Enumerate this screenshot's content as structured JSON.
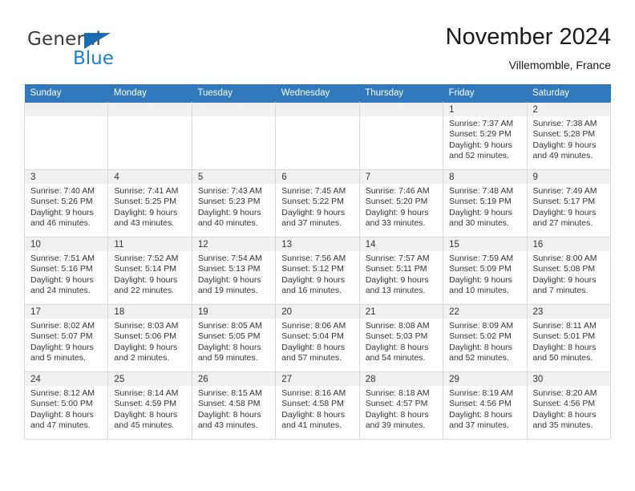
{
  "brand": {
    "name_part1": "General",
    "name_part2": "Blue",
    "accent_color": "#1b7fd4",
    "triangle_color": "#1b6cb5"
  },
  "header": {
    "title": "November 2024",
    "subtitle": "Villemomble, France"
  },
  "theme": {
    "header_row_color": "#3079bd",
    "day_band_color": "#f0f0f0",
    "cell_border_color": "#d9d9d9",
    "text_color": "#333333"
  },
  "weekday_headers": [
    "Sunday",
    "Monday",
    "Tuesday",
    "Wednesday",
    "Thursday",
    "Friday",
    "Saturday"
  ],
  "weeks": [
    [
      {
        "day": "",
        "empty": true
      },
      {
        "day": "",
        "empty": true
      },
      {
        "day": "",
        "empty": true
      },
      {
        "day": "",
        "empty": true
      },
      {
        "day": "",
        "empty": true
      },
      {
        "day": "1",
        "sunrise": "Sunrise: 7:37 AM",
        "sunset": "Sunset: 5:29 PM",
        "daylight_line1": "Daylight: 9 hours",
        "daylight_line2": "and 52 minutes."
      },
      {
        "day": "2",
        "sunrise": "Sunrise: 7:38 AM",
        "sunset": "Sunset: 5:28 PM",
        "daylight_line1": "Daylight: 9 hours",
        "daylight_line2": "and 49 minutes."
      }
    ],
    [
      {
        "day": "3",
        "sunrise": "Sunrise: 7:40 AM",
        "sunset": "Sunset: 5:26 PM",
        "daylight_line1": "Daylight: 9 hours",
        "daylight_line2": "and 46 minutes."
      },
      {
        "day": "4",
        "sunrise": "Sunrise: 7:41 AM",
        "sunset": "Sunset: 5:25 PM",
        "daylight_line1": "Daylight: 9 hours",
        "daylight_line2": "and 43 minutes."
      },
      {
        "day": "5",
        "sunrise": "Sunrise: 7:43 AM",
        "sunset": "Sunset: 5:23 PM",
        "daylight_line1": "Daylight: 9 hours",
        "daylight_line2": "and 40 minutes."
      },
      {
        "day": "6",
        "sunrise": "Sunrise: 7:45 AM",
        "sunset": "Sunset: 5:22 PM",
        "daylight_line1": "Daylight: 9 hours",
        "daylight_line2": "and 37 minutes."
      },
      {
        "day": "7",
        "sunrise": "Sunrise: 7:46 AM",
        "sunset": "Sunset: 5:20 PM",
        "daylight_line1": "Daylight: 9 hours",
        "daylight_line2": "and 33 minutes."
      },
      {
        "day": "8",
        "sunrise": "Sunrise: 7:48 AM",
        "sunset": "Sunset: 5:19 PM",
        "daylight_line1": "Daylight: 9 hours",
        "daylight_line2": "and 30 minutes."
      },
      {
        "day": "9",
        "sunrise": "Sunrise: 7:49 AM",
        "sunset": "Sunset: 5:17 PM",
        "daylight_line1": "Daylight: 9 hours",
        "daylight_line2": "and 27 minutes."
      }
    ],
    [
      {
        "day": "10",
        "sunrise": "Sunrise: 7:51 AM",
        "sunset": "Sunset: 5:16 PM",
        "daylight_line1": "Daylight: 9 hours",
        "daylight_line2": "and 24 minutes."
      },
      {
        "day": "11",
        "sunrise": "Sunrise: 7:52 AM",
        "sunset": "Sunset: 5:14 PM",
        "daylight_line1": "Daylight: 9 hours",
        "daylight_line2": "and 22 minutes."
      },
      {
        "day": "12",
        "sunrise": "Sunrise: 7:54 AM",
        "sunset": "Sunset: 5:13 PM",
        "daylight_line1": "Daylight: 9 hours",
        "daylight_line2": "and 19 minutes."
      },
      {
        "day": "13",
        "sunrise": "Sunrise: 7:56 AM",
        "sunset": "Sunset: 5:12 PM",
        "daylight_line1": "Daylight: 9 hours",
        "daylight_line2": "and 16 minutes."
      },
      {
        "day": "14",
        "sunrise": "Sunrise: 7:57 AM",
        "sunset": "Sunset: 5:11 PM",
        "daylight_line1": "Daylight: 9 hours",
        "daylight_line2": "and 13 minutes."
      },
      {
        "day": "15",
        "sunrise": "Sunrise: 7:59 AM",
        "sunset": "Sunset: 5:09 PM",
        "daylight_line1": "Daylight: 9 hours",
        "daylight_line2": "and 10 minutes."
      },
      {
        "day": "16",
        "sunrise": "Sunrise: 8:00 AM",
        "sunset": "Sunset: 5:08 PM",
        "daylight_line1": "Daylight: 9 hours",
        "daylight_line2": "and 7 minutes."
      }
    ],
    [
      {
        "day": "17",
        "sunrise": "Sunrise: 8:02 AM",
        "sunset": "Sunset: 5:07 PM",
        "daylight_line1": "Daylight: 9 hours",
        "daylight_line2": "and 5 minutes."
      },
      {
        "day": "18",
        "sunrise": "Sunrise: 8:03 AM",
        "sunset": "Sunset: 5:06 PM",
        "daylight_line1": "Daylight: 9 hours",
        "daylight_line2": "and 2 minutes."
      },
      {
        "day": "19",
        "sunrise": "Sunrise: 8:05 AM",
        "sunset": "Sunset: 5:05 PM",
        "daylight_line1": "Daylight: 8 hours",
        "daylight_line2": "and 59 minutes."
      },
      {
        "day": "20",
        "sunrise": "Sunrise: 8:06 AM",
        "sunset": "Sunset: 5:04 PM",
        "daylight_line1": "Daylight: 8 hours",
        "daylight_line2": "and 57 minutes."
      },
      {
        "day": "21",
        "sunrise": "Sunrise: 8:08 AM",
        "sunset": "Sunset: 5:03 PM",
        "daylight_line1": "Daylight: 8 hours",
        "daylight_line2": "and 54 minutes."
      },
      {
        "day": "22",
        "sunrise": "Sunrise: 8:09 AM",
        "sunset": "Sunset: 5:02 PM",
        "daylight_line1": "Daylight: 8 hours",
        "daylight_line2": "and 52 minutes."
      },
      {
        "day": "23",
        "sunrise": "Sunrise: 8:11 AM",
        "sunset": "Sunset: 5:01 PM",
        "daylight_line1": "Daylight: 8 hours",
        "daylight_line2": "and 50 minutes."
      }
    ],
    [
      {
        "day": "24",
        "sunrise": "Sunrise: 8:12 AM",
        "sunset": "Sunset: 5:00 PM",
        "daylight_line1": "Daylight: 8 hours",
        "daylight_line2": "and 47 minutes."
      },
      {
        "day": "25",
        "sunrise": "Sunrise: 8:14 AM",
        "sunset": "Sunset: 4:59 PM",
        "daylight_line1": "Daylight: 8 hours",
        "daylight_line2": "and 45 minutes."
      },
      {
        "day": "26",
        "sunrise": "Sunrise: 8:15 AM",
        "sunset": "Sunset: 4:58 PM",
        "daylight_line1": "Daylight: 8 hours",
        "daylight_line2": "and 43 minutes."
      },
      {
        "day": "27",
        "sunrise": "Sunrise: 8:16 AM",
        "sunset": "Sunset: 4:58 PM",
        "daylight_line1": "Daylight: 8 hours",
        "daylight_line2": "and 41 minutes."
      },
      {
        "day": "28",
        "sunrise": "Sunrise: 8:18 AM",
        "sunset": "Sunset: 4:57 PM",
        "daylight_line1": "Daylight: 8 hours",
        "daylight_line2": "and 39 minutes."
      },
      {
        "day": "29",
        "sunrise": "Sunrise: 8:19 AM",
        "sunset": "Sunset: 4:56 PM",
        "daylight_line1": "Daylight: 8 hours",
        "daylight_line2": "and 37 minutes."
      },
      {
        "day": "30",
        "sunrise": "Sunrise: 8:20 AM",
        "sunset": "Sunset: 4:56 PM",
        "daylight_line1": "Daylight: 8 hours",
        "daylight_line2": "and 35 minutes."
      }
    ]
  ]
}
